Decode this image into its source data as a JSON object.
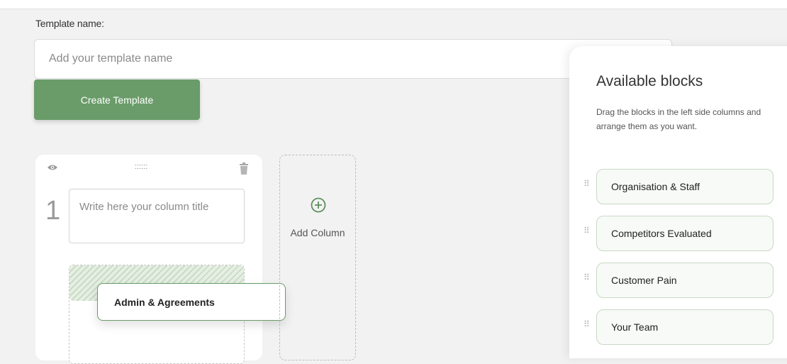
{
  "template": {
    "label": "Template name:",
    "placeholder": "Add your template name",
    "value": ""
  },
  "create_button": "Create Template",
  "column": {
    "number": "1",
    "drag_handle": "::::::",
    "title_placeholder": "Write here your column title",
    "dragging_block": "Admin & Agreements"
  },
  "add_column": "Add Column",
  "panel": {
    "title": "Available blocks",
    "description": "Drag the blocks in the left side columns and arrange them as you want.",
    "blocks": [
      {
        "label": "Organisation & Staff"
      },
      {
        "label": "Competitors Evaluated"
      },
      {
        "label": "Customer Pain"
      },
      {
        "label": "Your Team"
      }
    ]
  },
  "colors": {
    "accent": "#6a9c69",
    "chip_border": "#c8d9c5",
    "background": "#f2f2f2"
  },
  "icons": [
    "eye-icon",
    "trash-icon",
    "plus-circle-icon",
    "drag-handle-icon"
  ]
}
